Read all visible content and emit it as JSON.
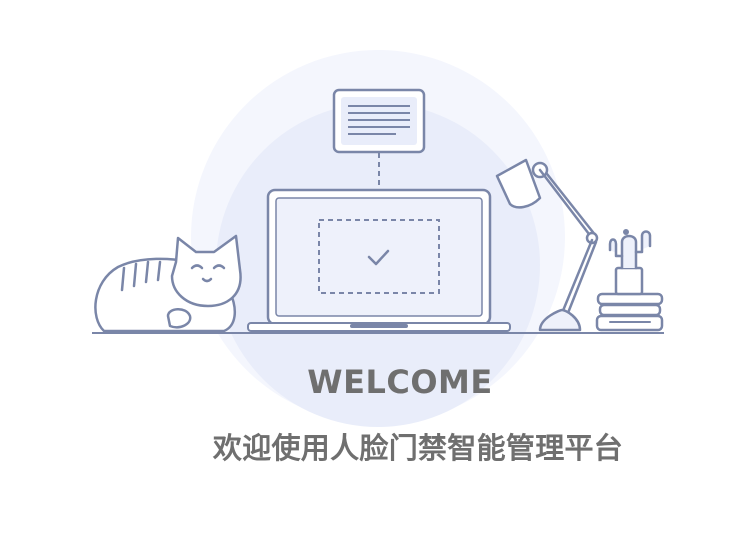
{
  "welcome": {
    "title": "WELCOME",
    "subtitle": "欢迎使用人脸门禁智能管理平台"
  },
  "colors": {
    "line": "#7a86a8",
    "fill_light": "#eef1fb",
    "fill_lighter": "#f5f7fd",
    "text": "#6f6f6f"
  }
}
